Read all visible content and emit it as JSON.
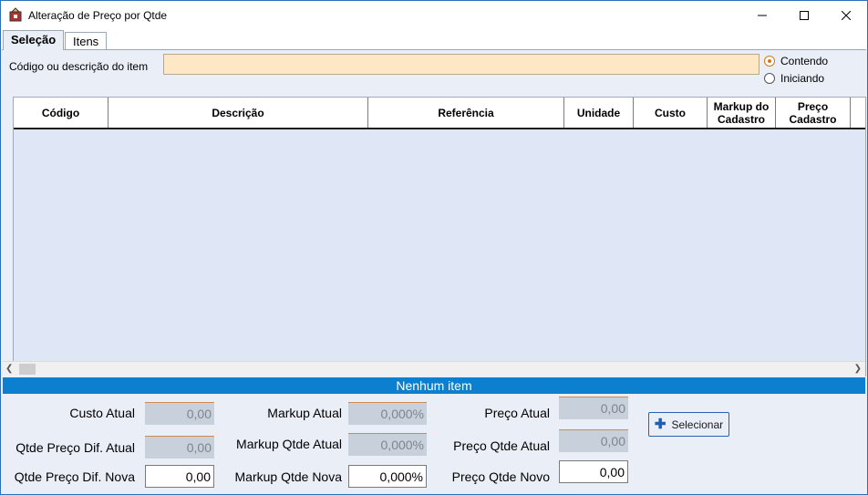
{
  "window": {
    "title": "Alteração de Preço por Qtde",
    "icon": "app-icon"
  },
  "tabs": [
    {
      "label": "Seleção",
      "active": true
    },
    {
      "label": "Itens",
      "active": false
    }
  ],
  "search": {
    "label": "Código ou descrição do item",
    "value": "",
    "placeholder": ""
  },
  "match_mode": {
    "options": [
      {
        "label": "Contendo",
        "checked": true
      },
      {
        "label": "Iniciando",
        "checked": false
      }
    ]
  },
  "grid": {
    "columns": [
      {
        "label": "Código"
      },
      {
        "label": "Descrição"
      },
      {
        "label": "Referência"
      },
      {
        "label": "Unidade"
      },
      {
        "label": "Custo"
      },
      {
        "label": "Markup do Cadastro"
      },
      {
        "label": "Preço Cadastro"
      }
    ],
    "rows": [],
    "status_text": "Nenhum item"
  },
  "summary": {
    "custo_atual": {
      "label": "Custo Atual",
      "value": "0,00"
    },
    "qtde_preco_dif_atual": {
      "label": "Qtde Preço Dif. Atual",
      "value": "0,00"
    },
    "qtde_preco_dif_nova": {
      "label": "Qtde Preço Dif. Nova",
      "value": "0,00"
    },
    "markup_atual": {
      "label": "Markup Atual",
      "value": "0,000%"
    },
    "markup_qtde_atual": {
      "label": "Markup Qtde Atual",
      "value": "0,000%"
    },
    "markup_qtde_nova": {
      "label": "Markup Qtde Nova",
      "value": "0,000%"
    },
    "preco_atual": {
      "label": "Preço Atual",
      "value": "0,00"
    },
    "preco_qtde_atual": {
      "label": "Preço Qtde Atual",
      "value": "0,00"
    },
    "preco_qtde_novo": {
      "label": "Preço Qtde Novo",
      "value": "0,00"
    }
  },
  "actions": {
    "select_label": "Selecionar",
    "select_icon": "plus-icon"
  },
  "colors": {
    "status_bar": "#0c80cf",
    "search_bg": "#fde7c4",
    "grid_bg": "#dfe6f6"
  }
}
